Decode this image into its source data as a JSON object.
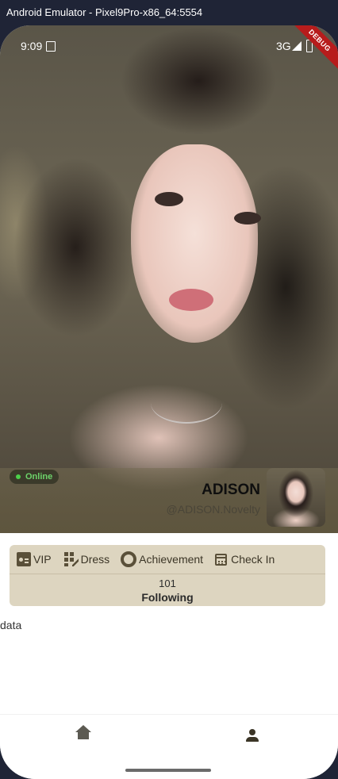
{
  "window": {
    "title": "Android Emulator - Pixel9Pro-x86_64:5554"
  },
  "status_bar": {
    "time": "9:09",
    "network": "3G",
    "debug_banner": "DEBUG"
  },
  "profile": {
    "status": "Online",
    "name": "ADISON",
    "handle": "@ADISON.Novelty"
  },
  "menu": {
    "items": [
      {
        "label": "VIP",
        "icon": "vip-card-icon"
      },
      {
        "label": "Dress",
        "icon": "dress-grid-icon"
      },
      {
        "label": "Achievement",
        "icon": "achievement-ring-icon"
      },
      {
        "label": "Check In",
        "icon": "calendar-icon"
      }
    ],
    "following_count": "101",
    "following_label": "Following"
  },
  "content": {
    "text": "data"
  },
  "bottom_nav": {
    "items": [
      {
        "icon": "home-icon"
      },
      {
        "icon": "person-icon"
      }
    ]
  },
  "colors": {
    "accent_card": "#ddd5c0",
    "online_green": "#4cd04a",
    "debug_red": "#b71c1c"
  }
}
